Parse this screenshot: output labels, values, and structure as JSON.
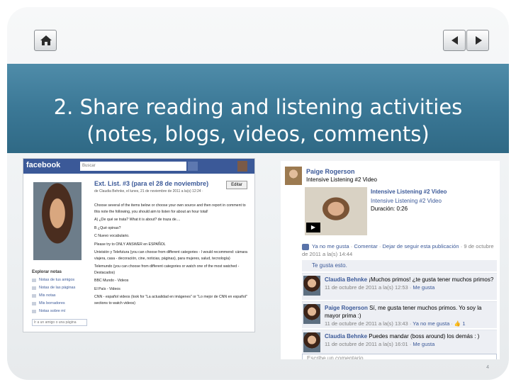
{
  "slide": {
    "title_line1": "2. Share reading and listening activities",
    "title_line2": "(notes, blogs, videos, comments)",
    "number": "4",
    "nav": {
      "home_icon": "home-icon",
      "back_icon": "arrow-left-icon",
      "forward_icon": "arrow-right-icon"
    }
  },
  "left_screenshot": {
    "logo": "facebook",
    "search_placeholder": "Buscar",
    "note_title": "Ext. List. #3 (para el 28 de noviembre)",
    "note_meta": "de Claudia Behnke, el lunes, 21 de noviembre de 2011 a la(s) 12:24 · ",
    "edit_label": "Editar",
    "paragraphs": [
      "Choose several of the items below or choose your own source and then report in comment to this note the following, you should aim to listen for about an hour total!",
      "A) ¿De qué se trata? What it is about? de traza de....",
      "B ¿Qué opinas?",
      "C Nuevo vocabulario.",
      "Please try to ONLY ANSWER en ESPAÑOL",
      "Univisión y Telefutura (you can choose from different categories - I would recommend: cámara viajera, casa - decoración, cine, noticias, páginas), para mujeres, salud, tecnología)",
      "Telemundo (you can choose from different categories or watch one of the most watched - Destacados)",
      "BBC Mundo - Videos",
      "El País - Videos",
      "CNN - español videos (look for \"La actualidad en imágenes\" or \"Lo mejor de CNN en español\" sections to watch videos)"
    ],
    "explore_heading": "Explorar notas",
    "explore_items": [
      "Notas de tus amigos",
      "Notas de las páginas",
      "Mis notas",
      "Mis borradores",
      "Notas sobre mí"
    ],
    "explore_input": "Ir a un amigo o una página"
  },
  "right_screenshot": {
    "author": "Paige Rogerson",
    "post_subtitle": "Intensive Listening #2 Video",
    "play_label": "▶",
    "video_title": "Intensive Listening #2 Video",
    "video_line2": "Intensive Listening #2 Video",
    "duration_label": "Duración:",
    "duration_value": "0:26",
    "action_unlike": "Ya no me gusta",
    "action_comment": "Comentar",
    "action_unfollow": "Dejar de seguir esta publicación",
    "action_date": "9 de octubre de 2011 a la(s) 14:44",
    "likes_text": "Te gusta esto.",
    "comments": [
      {
        "name": "Claudia Behnke",
        "text": "¡Muchos primos! ¿te gusta tener muchos primos?",
        "date": "11 de octubre de 2011 a la(s) 12:53",
        "action": "Me gusta",
        "extra": ""
      },
      {
        "name": "Paige Rogerson",
        "text": "Sí, me gusta tener muchos primos. Yo soy la mayor prima :)",
        "date": "11 de octubre de 2011 a la(s) 13:43",
        "action": "Ya no me gusta",
        "extra": "1"
      },
      {
        "name": "Claudia Behnke",
        "text": "Puedes mandar (boss around) los demás : )",
        "date": "11 de octubre de 2011 a la(s) 16:01",
        "action": "Me gusta",
        "extra": ""
      }
    ],
    "comment_placeholder": "Escribe un comentario..."
  }
}
